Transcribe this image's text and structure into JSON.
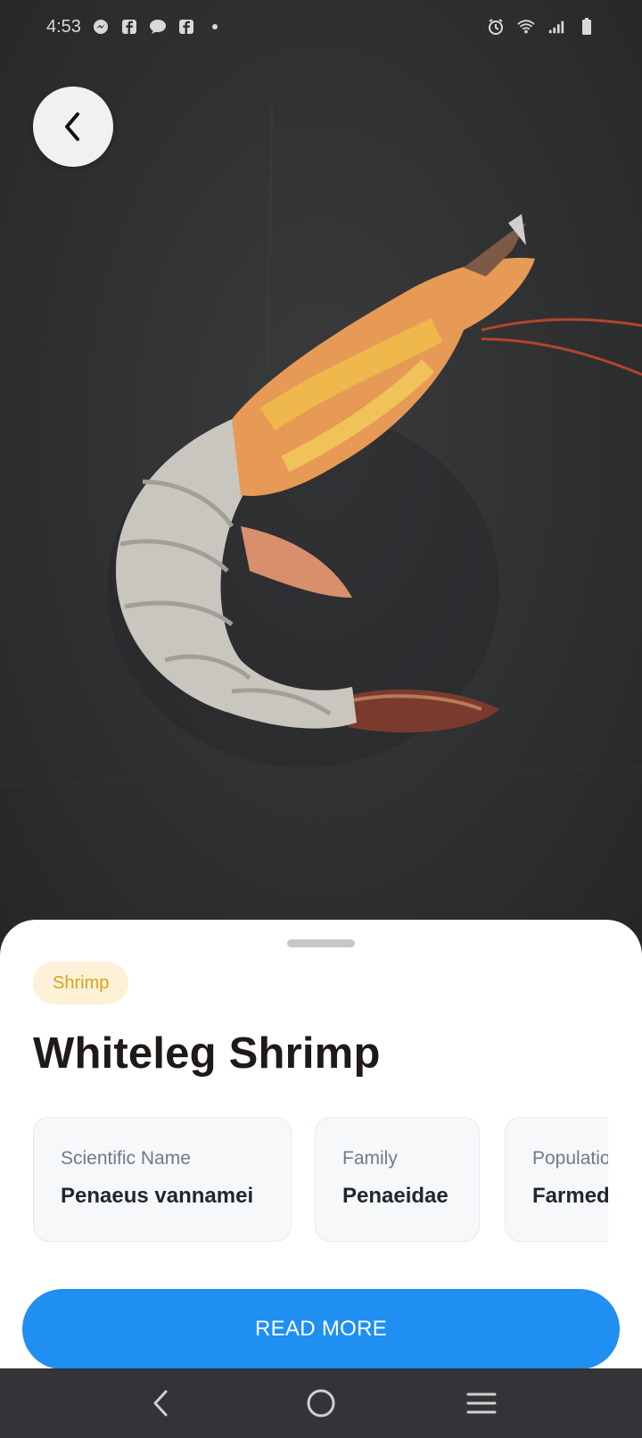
{
  "status_bar": {
    "time": "4:53",
    "left_icons": [
      "messenger-icon",
      "facebook-icon",
      "chat-icon",
      "facebook-icon",
      "dot-icon"
    ],
    "right_icons": [
      "alarm-icon",
      "wifi-icon",
      "signal-icon",
      "battery-icon"
    ]
  },
  "photo": {
    "subject": "shrimp-photo"
  },
  "sheet": {
    "category": "Shrimp",
    "title": "Whiteleg Shrimp",
    "cards": [
      {
        "label": "Scientific Name",
        "value": "Penaeus vannamei"
      },
      {
        "label": "Family",
        "value": "Penaeidae"
      },
      {
        "label": "Population",
        "value": "Farmed"
      }
    ],
    "read_more_label": "READ MORE"
  },
  "colors": {
    "accent": "#1f8ff1",
    "chip_bg": "#fdf1d8",
    "chip_text": "#d9a31b"
  }
}
